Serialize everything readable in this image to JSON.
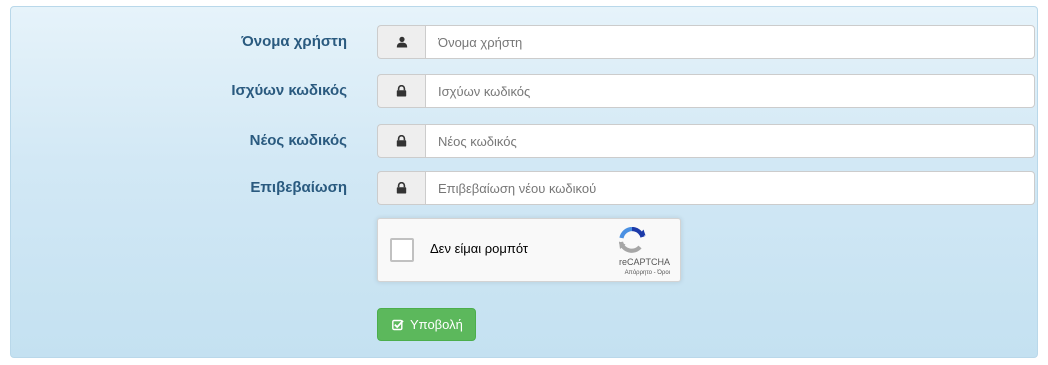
{
  "form": {
    "fields": [
      {
        "label": "Όνομα χρήστη",
        "placeholder": "Όνομα χρήστη",
        "value": "",
        "icon": "user-icon"
      },
      {
        "label": "Ισχύων κωδικός",
        "placeholder": "Ισχύων κωδικός",
        "value": "",
        "icon": "lock-icon"
      },
      {
        "label": "Νέος κωδικός",
        "placeholder": "Νέος κωδικός",
        "value": "",
        "icon": "lock-icon"
      },
      {
        "label": "Επιβεβαίωση",
        "placeholder": "Επιβεβαίωση νέου κωδικού",
        "value": "",
        "icon": "lock-icon"
      }
    ],
    "captcha": {
      "label": "Δεν είμαι ρομπότ",
      "brand": "reCAPTCHA",
      "links": "Απόρρητο - Όροι",
      "icon": "recaptcha-logo-icon"
    },
    "submit": {
      "label": "Υποβολή",
      "icon": "check-square-icon"
    }
  },
  "colors": {
    "label_text": "#2a5a7f",
    "panel_bg": "#d2e8f5",
    "submit_bg": "#5cb85c",
    "captcha_blue": "#1c3aa9",
    "captcha_light_blue": "#4a90e2",
    "captcha_gray": "#a6a6a6"
  }
}
